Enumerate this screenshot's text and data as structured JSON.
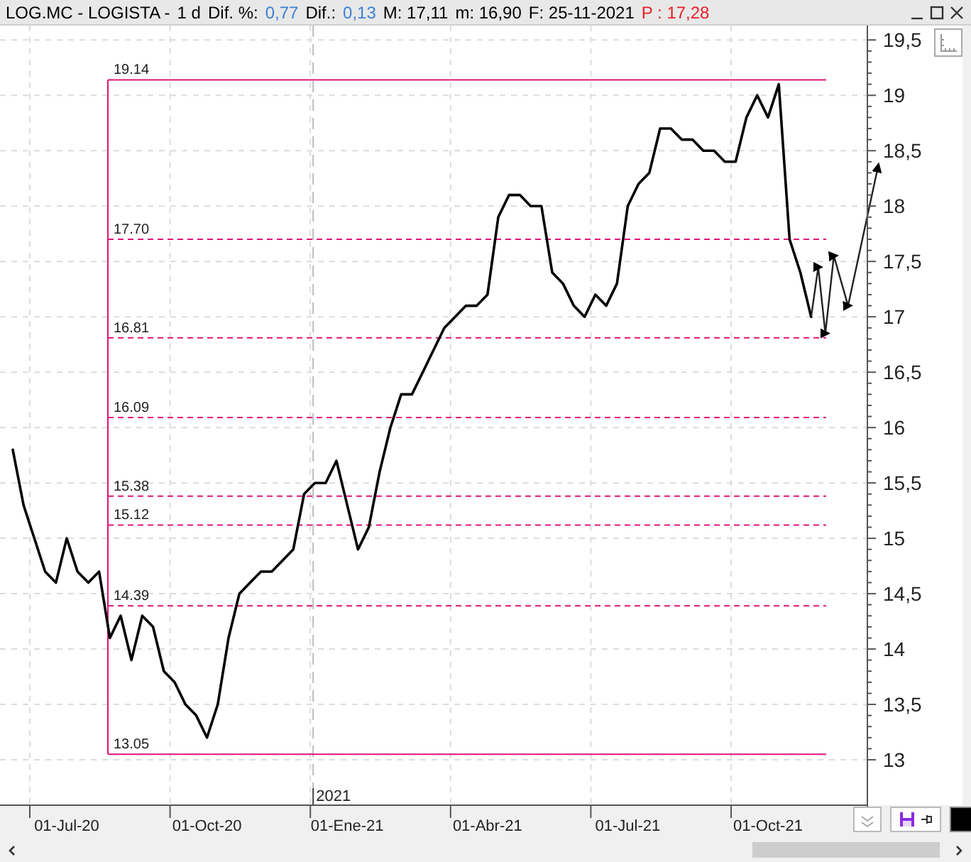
{
  "header": {
    "fields": [
      {
        "text": "LOG.MC - LOGISTA -",
        "color": "#000000"
      },
      {
        "text": "1 d",
        "color": "#000000"
      },
      {
        "text": "Dif. %:",
        "color": "#000000"
      },
      {
        "text": "0,77",
        "color": "#3b82d6"
      },
      {
        "text": "Dif.:",
        "color": "#000000"
      },
      {
        "text": "0,13",
        "color": "#3b82d6"
      },
      {
        "text": "M: 17,11",
        "color": "#000000"
      },
      {
        "text": "m: 16,90",
        "color": "#000000"
      },
      {
        "text": "F: 25-11-2021",
        "color": "#000000"
      },
      {
        "text": "P : 17,28",
        "color": "#e8202a"
      }
    ]
  },
  "chart": {
    "year_label": "2021",
    "chart_data": {
      "type": "line",
      "grid": true,
      "categories": [
        null,
        null,
        null,
        null,
        null,
        null,
        "01-Jul-20",
        null,
        null,
        null,
        null,
        null,
        null,
        null,
        null,
        null,
        null,
        null,
        null,
        "01-Oct-20",
        null,
        null,
        null,
        null,
        null,
        null,
        null,
        null,
        null,
        null,
        null,
        null,
        "01-Ene-21",
        null,
        null,
        null,
        null,
        null,
        null,
        null,
        null,
        null,
        null,
        null,
        null,
        "01-Abr-21",
        null,
        null,
        null,
        null,
        null,
        null,
        null,
        null,
        null,
        null,
        null,
        null,
        "01-Jul-21",
        null,
        null,
        null,
        null,
        null,
        null,
        null,
        null,
        null,
        null,
        null,
        null,
        "01-Oct-21",
        null,
        null,
        null,
        null
      ],
      "series": [
        {
          "color": "#000000",
          "values": [
            null,
            15.8,
            15.3,
            15.0,
            14.7,
            14.6,
            15.0,
            14.7,
            14.6,
            14.7,
            14.1,
            14.3,
            13.9,
            14.3,
            14.2,
            13.8,
            13.7,
            13.5,
            13.4,
            13.2,
            13.5,
            14.1,
            14.5,
            14.6,
            14.7,
            14.7,
            14.8,
            14.9,
            15.4,
            15.5,
            15.5,
            15.7,
            15.3,
            14.9,
            15.1,
            15.6,
            16.0,
            16.3,
            16.3,
            16.5,
            16.7,
            16.9,
            17.0,
            17.1,
            17.1,
            17.2,
            17.9,
            18.1,
            18.1,
            18.0,
            18.0,
            17.4,
            17.3,
            17.1,
            17.0,
            17.2,
            17.1,
            17.3,
            18.0,
            18.2,
            18.3,
            18.7,
            18.7,
            18.6,
            18.6,
            18.5,
            18.5,
            18.4,
            18.4,
            18.8,
            19.0,
            18.8,
            19.1,
            17.7,
            17.4,
            17.0
          ]
        }
      ],
      "ylim": [
        12.59,
        19.63
      ],
      "yticks": [
        {
          "value": 13,
          "label": "13"
        },
        {
          "value": 13.5,
          "label": "13,5"
        },
        {
          "value": 14,
          "label": "14"
        },
        {
          "value": 14.5,
          "label": "14,5"
        },
        {
          "value": 15,
          "label": "15"
        },
        {
          "value": 15.5,
          "label": "15,5"
        },
        {
          "value": 16,
          "label": "16"
        },
        {
          "value": 16.5,
          "label": "16,5"
        },
        {
          "value": 17,
          "label": "17"
        },
        {
          "value": 17.5,
          "label": "17,5"
        },
        {
          "value": 18,
          "label": "18"
        },
        {
          "value": 18.5,
          "label": "18,5"
        },
        {
          "value": 19,
          "label": "19"
        },
        {
          "value": 19.5,
          "label": "19,5"
        }
      ],
      "ref_lines": [
        {
          "axis": "y",
          "value": 19.14,
          "label": "19.14"
        },
        {
          "axis": "y",
          "value": 17.7,
          "label": "17.70"
        },
        {
          "axis": "y",
          "value": 16.81,
          "label": "16.81"
        },
        {
          "axis": "y",
          "value": 16.09,
          "label": "16.09"
        },
        {
          "axis": "y",
          "value": 15.38,
          "label": "15.38"
        },
        {
          "axis": "y",
          "value": 15.12,
          "label": "15.12"
        },
        {
          "axis": "y",
          "value": 14.39,
          "label": "14.39"
        },
        {
          "axis": "y",
          "value": 13.05,
          "label": "13.05"
        }
      ]
    }
  }
}
